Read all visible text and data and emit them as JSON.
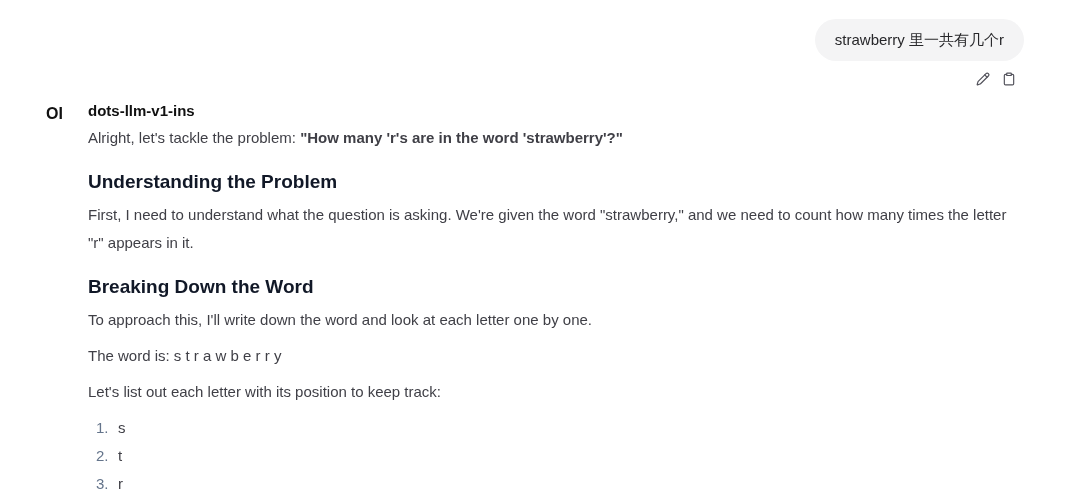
{
  "user_message": {
    "text": "strawberry 里一共有几个r"
  },
  "assistant": {
    "avatar": "OI",
    "model_name": "dots-llm-v1-ins",
    "blocks": [
      {
        "kind": "paragraph",
        "text": "Alright, let's tackle the problem: **\"How many 'r's are in the word 'strawberry'?\"**"
      },
      {
        "kind": "heading",
        "text": "Understanding the Problem"
      },
      {
        "kind": "paragraph",
        "text": "First, I need to understand what the question is asking. We're given the word \"strawberry,\" and we need to count how many times the letter \"r\" appears in it."
      },
      {
        "kind": "heading",
        "text": "Breaking Down the Word"
      },
      {
        "kind": "paragraph",
        "text": "To approach this, I'll write down the word and look at each letter one by one."
      },
      {
        "kind": "paragraph",
        "text": "The word is: s t r a w b e r r y"
      },
      {
        "kind": "paragraph",
        "text": "Let's list out each letter with its position to keep track:"
      },
      {
        "kind": "list",
        "items": [
          {
            "number": "1.",
            "text": "s"
          },
          {
            "number": "2.",
            "text": "t"
          },
          {
            "number": "3.",
            "text": "r"
          }
        ]
      }
    ]
  }
}
